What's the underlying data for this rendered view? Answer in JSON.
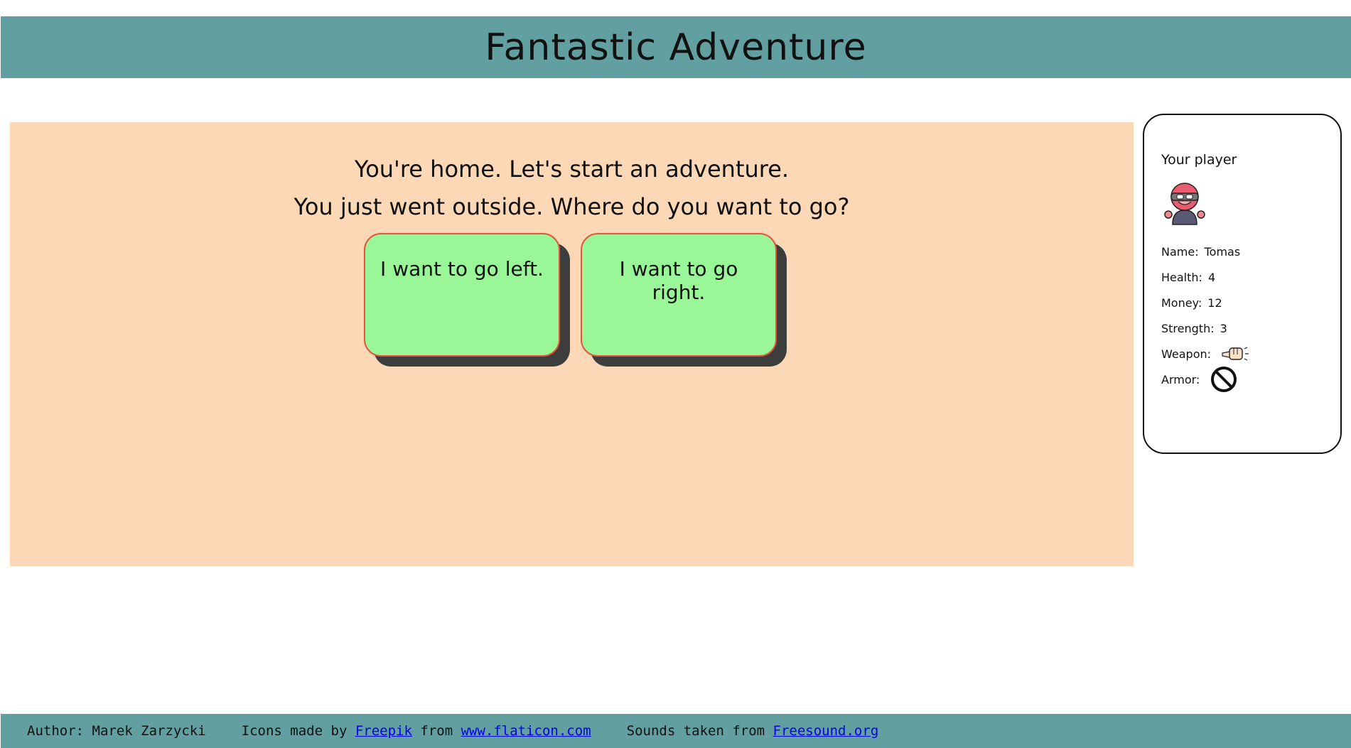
{
  "header": {
    "title": "Fantastic Adventure"
  },
  "story": {
    "line1": "You're home. Let's start an adventure.",
    "line2": "You just went outside. Where do you want to go?"
  },
  "choices": [
    {
      "label": "I want to go left."
    },
    {
      "label": "I want to go right."
    }
  ],
  "player": {
    "title": "Your player",
    "avatar_icon": "ninja-avatar-icon",
    "name_label": "Name:",
    "name": "Tomas",
    "health_label": "Health:",
    "health": "4",
    "money_label": "Money:",
    "money": "12",
    "strength_label": "Strength:",
    "strength": "3",
    "weapon_label": "Weapon:",
    "weapon_icon": "fist-icon",
    "armor_label": "Armor:",
    "armor_icon": "none-prohibited-icon"
  },
  "footer": {
    "author": "Author: Marek Zarzycki",
    "icons_prefix": "Icons made by",
    "freepik_link": "Freepik",
    "from_text": "from",
    "flaticon_link": "www.flaticon.com",
    "sounds_prefix": "Sounds taken from",
    "freesound_link": "Freesound.org"
  },
  "colors": {
    "header_bg": "#619fa0",
    "stage_bg": "#fcd8b6",
    "choice_bg": "#9af798",
    "choice_border": "#e2563c",
    "link": "#0000ee"
  }
}
